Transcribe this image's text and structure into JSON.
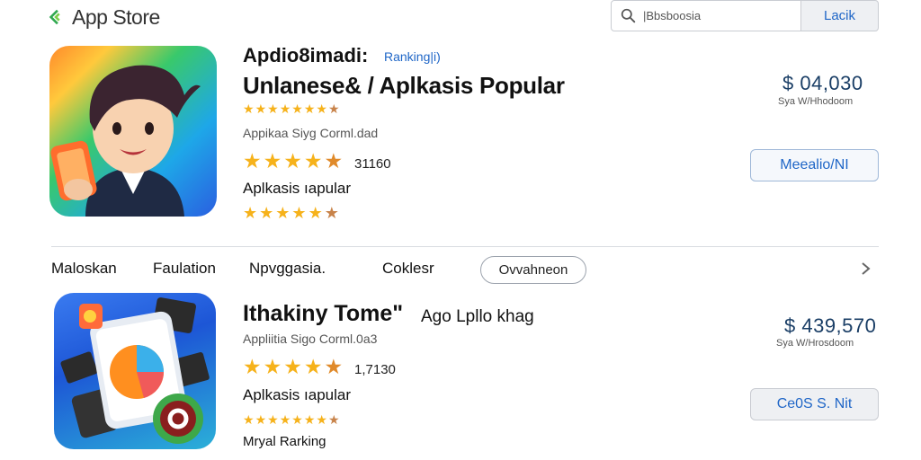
{
  "header": {
    "logo_text": "App Store",
    "search_value": "|Bbsboosia",
    "search_button": "Lacik",
    "accent": "#1f66c7",
    "logo_color": "#2fa84f"
  },
  "featured": {
    "title_line1": "Apdio8imadi:",
    "ranking_tag": "Ranking|i)",
    "title_line2": "Unlanese& / Aplkasis Popular",
    "meta": "Appikaa Siyg Corml.dad",
    "rating_count": "31160",
    "label1": "Aplkasis ıapular",
    "price": "$ 04,030",
    "price_sub": "Sya W/Hhodoom",
    "action_button": "Meealio/NI"
  },
  "tabs": [
    {
      "label": "Maloskan"
    },
    {
      "label": "Faulation"
    },
    {
      "label": "Npvggasia."
    },
    {
      "label": "Coklesr"
    },
    {
      "label": "Ovvahneon"
    }
  ],
  "second": {
    "title": "Ithakiny Tome\"",
    "subtitle": "Ago Lpllo khag",
    "meta": "Appliitia Sigo Corml.0a3",
    "rating_count": "1,7130",
    "label1": "Aplkasis ıapular",
    "label2": "Mryal Rarking",
    "price": "$ 439,570",
    "price_sub": "Sya W/Hrosdoom",
    "action_button": "Ce0S S. Nit"
  },
  "icons": [
    "search-icon",
    "chevron-right-icon",
    "app-store-logo-icon"
  ]
}
